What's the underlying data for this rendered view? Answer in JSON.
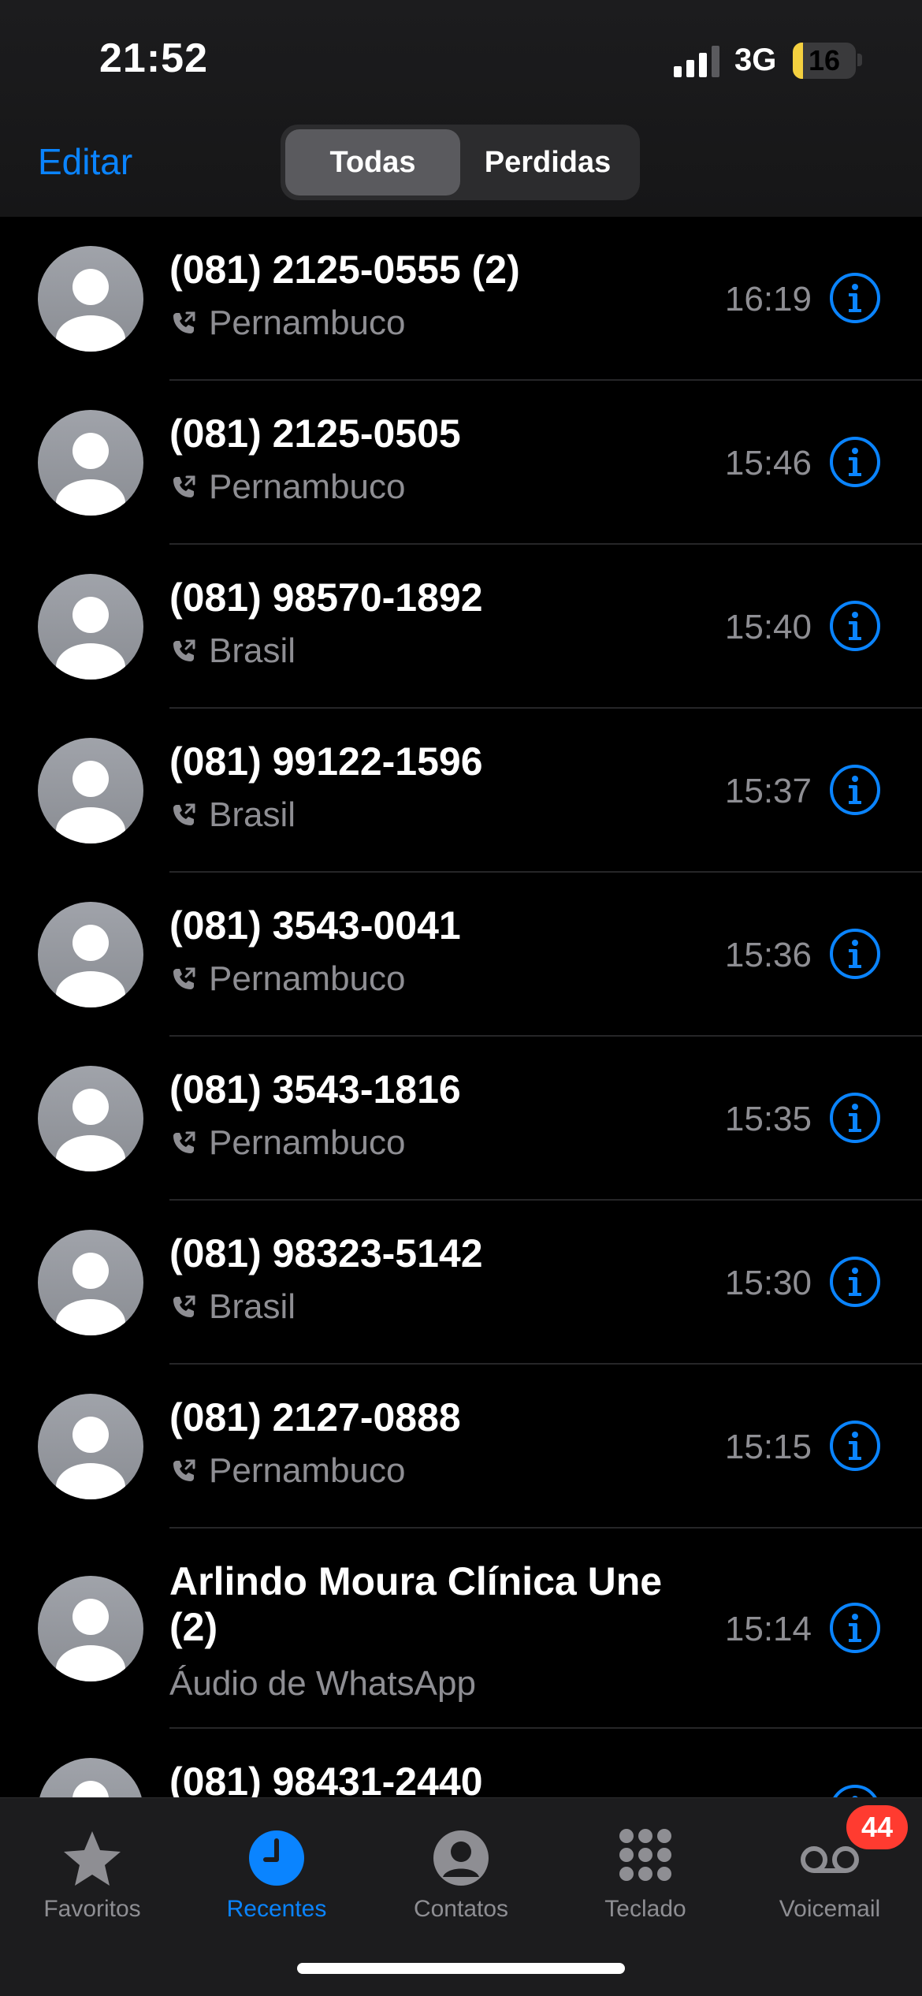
{
  "status_bar": {
    "time": "21:52",
    "network": "3G",
    "battery": "16",
    "battery_level": 0.16
  },
  "nav": {
    "edit_label": "Editar",
    "segments": [
      {
        "label": "Todas",
        "active": true
      },
      {
        "label": "Perdidas",
        "active": false
      }
    ]
  },
  "calls": [
    {
      "name": "(081) 2125-0555 (2)",
      "subtitle": "Pernambuco",
      "time": "16:19",
      "show_phone_icon": true
    },
    {
      "name": "(081) 2125-0505",
      "subtitle": "Pernambuco",
      "time": "15:46",
      "show_phone_icon": true
    },
    {
      "name": "(081) 98570-1892",
      "subtitle": "Brasil",
      "time": "15:40",
      "show_phone_icon": true
    },
    {
      "name": "(081) 99122-1596",
      "subtitle": "Brasil",
      "time": "15:37",
      "show_phone_icon": true
    },
    {
      "name": "(081) 3543-0041",
      "subtitle": "Pernambuco",
      "time": "15:36",
      "show_phone_icon": true
    },
    {
      "name": "(081) 3543-1816",
      "subtitle": "Pernambuco",
      "time": "15:35",
      "show_phone_icon": true
    },
    {
      "name": "(081) 98323-5142",
      "subtitle": "Brasil",
      "time": "15:30",
      "show_phone_icon": true
    },
    {
      "name": "(081) 2127-0888",
      "subtitle": "Pernambuco",
      "time": "15:15",
      "show_phone_icon": true
    },
    {
      "name": "Arlindo Moura Clínica Une (2)",
      "subtitle": "Áudio de WhatsApp",
      "time": "15:14",
      "show_phone_icon": false
    },
    {
      "name": "(081) 98431-2440",
      "subtitle": "",
      "time": "",
      "show_phone_icon": false
    }
  ],
  "tabbar": {
    "tabs": [
      {
        "label": "Favoritos",
        "icon": "star-icon",
        "active": false
      },
      {
        "label": "Recentes",
        "icon": "clock-icon",
        "active": true
      },
      {
        "label": "Contatos",
        "icon": "person-circle-icon",
        "active": false
      },
      {
        "label": "Teclado",
        "icon": "keypad-icon",
        "active": false
      },
      {
        "label": "Voicemail",
        "icon": "voicemail-icon",
        "active": false
      }
    ],
    "voicemail_badge": "44"
  },
  "colors": {
    "accent": "#0a84ff",
    "badge": "#ff3b30",
    "secondary_text": "#8e8e93",
    "battery": "#f4d03f"
  }
}
